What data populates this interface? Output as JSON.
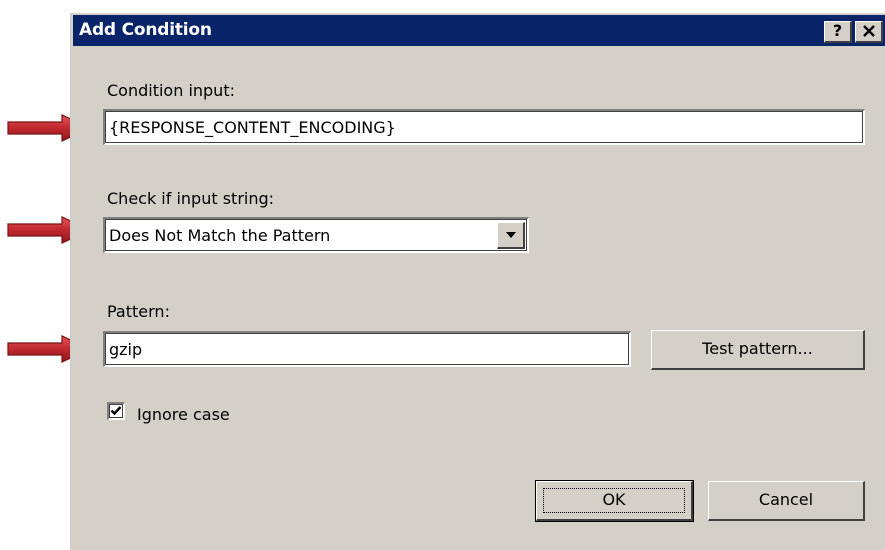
{
  "dialog": {
    "title": "Add Condition",
    "help_button": "?",
    "close_button": "✕"
  },
  "condition_input": {
    "label": "Condition input:",
    "value": "{RESPONSE_CONTENT_ENCODING}"
  },
  "check_if": {
    "label": "Check if input string:",
    "selected": "Does Not Match the Pattern"
  },
  "pattern": {
    "label": "Pattern:",
    "value": "gzip",
    "test_button": "Test pattern..."
  },
  "ignore_case": {
    "label": "Ignore case",
    "checked": true
  },
  "buttons": {
    "ok": "OK",
    "cancel": "Cancel"
  },
  "colors": {
    "titlebar": "#0a246a",
    "dialog_face": "#d4d0c8",
    "arrow": "#c0282d"
  }
}
